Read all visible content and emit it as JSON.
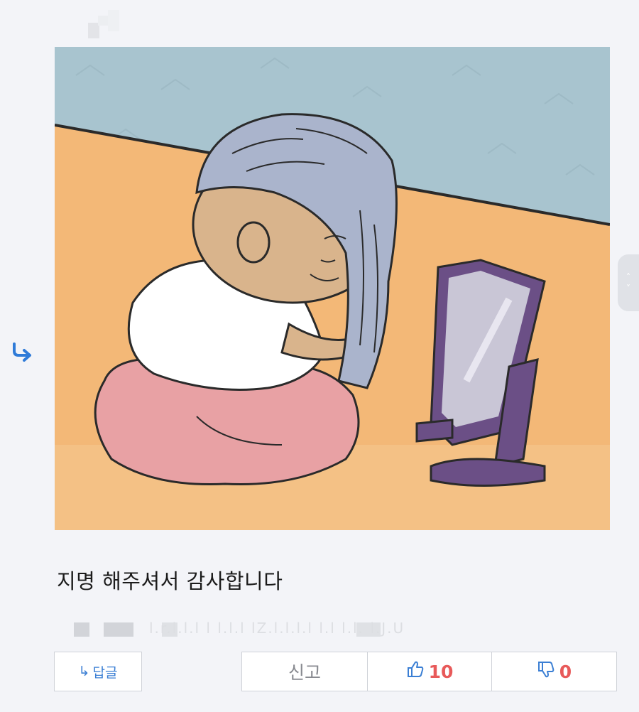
{
  "comment": {
    "text": "지명 해주셔서 감사합니다",
    "meta_obscured": "l.r.l.l.l l l.l.l lZ.l.l.l.l l.l l.l. l.J.U"
  },
  "buttons": {
    "reply_icon": "↳",
    "reply_label": "답글",
    "report_label": "신고",
    "like_count": "10",
    "dislike_count": "0"
  },
  "icons": {
    "reply_arrow": "reply-arrow-icon",
    "like": "thumbs-up-icon",
    "dislike": "thumbs-down-icon",
    "scroll_up": "chevron-up-icon",
    "scroll_down": "chevron-down-icon"
  },
  "scroll": {
    "up": "˄",
    "down": "˅"
  },
  "colors": {
    "accent_blue": "#3b7fd4",
    "vote_red": "#e85a5a",
    "background": "#f3f4f8"
  }
}
